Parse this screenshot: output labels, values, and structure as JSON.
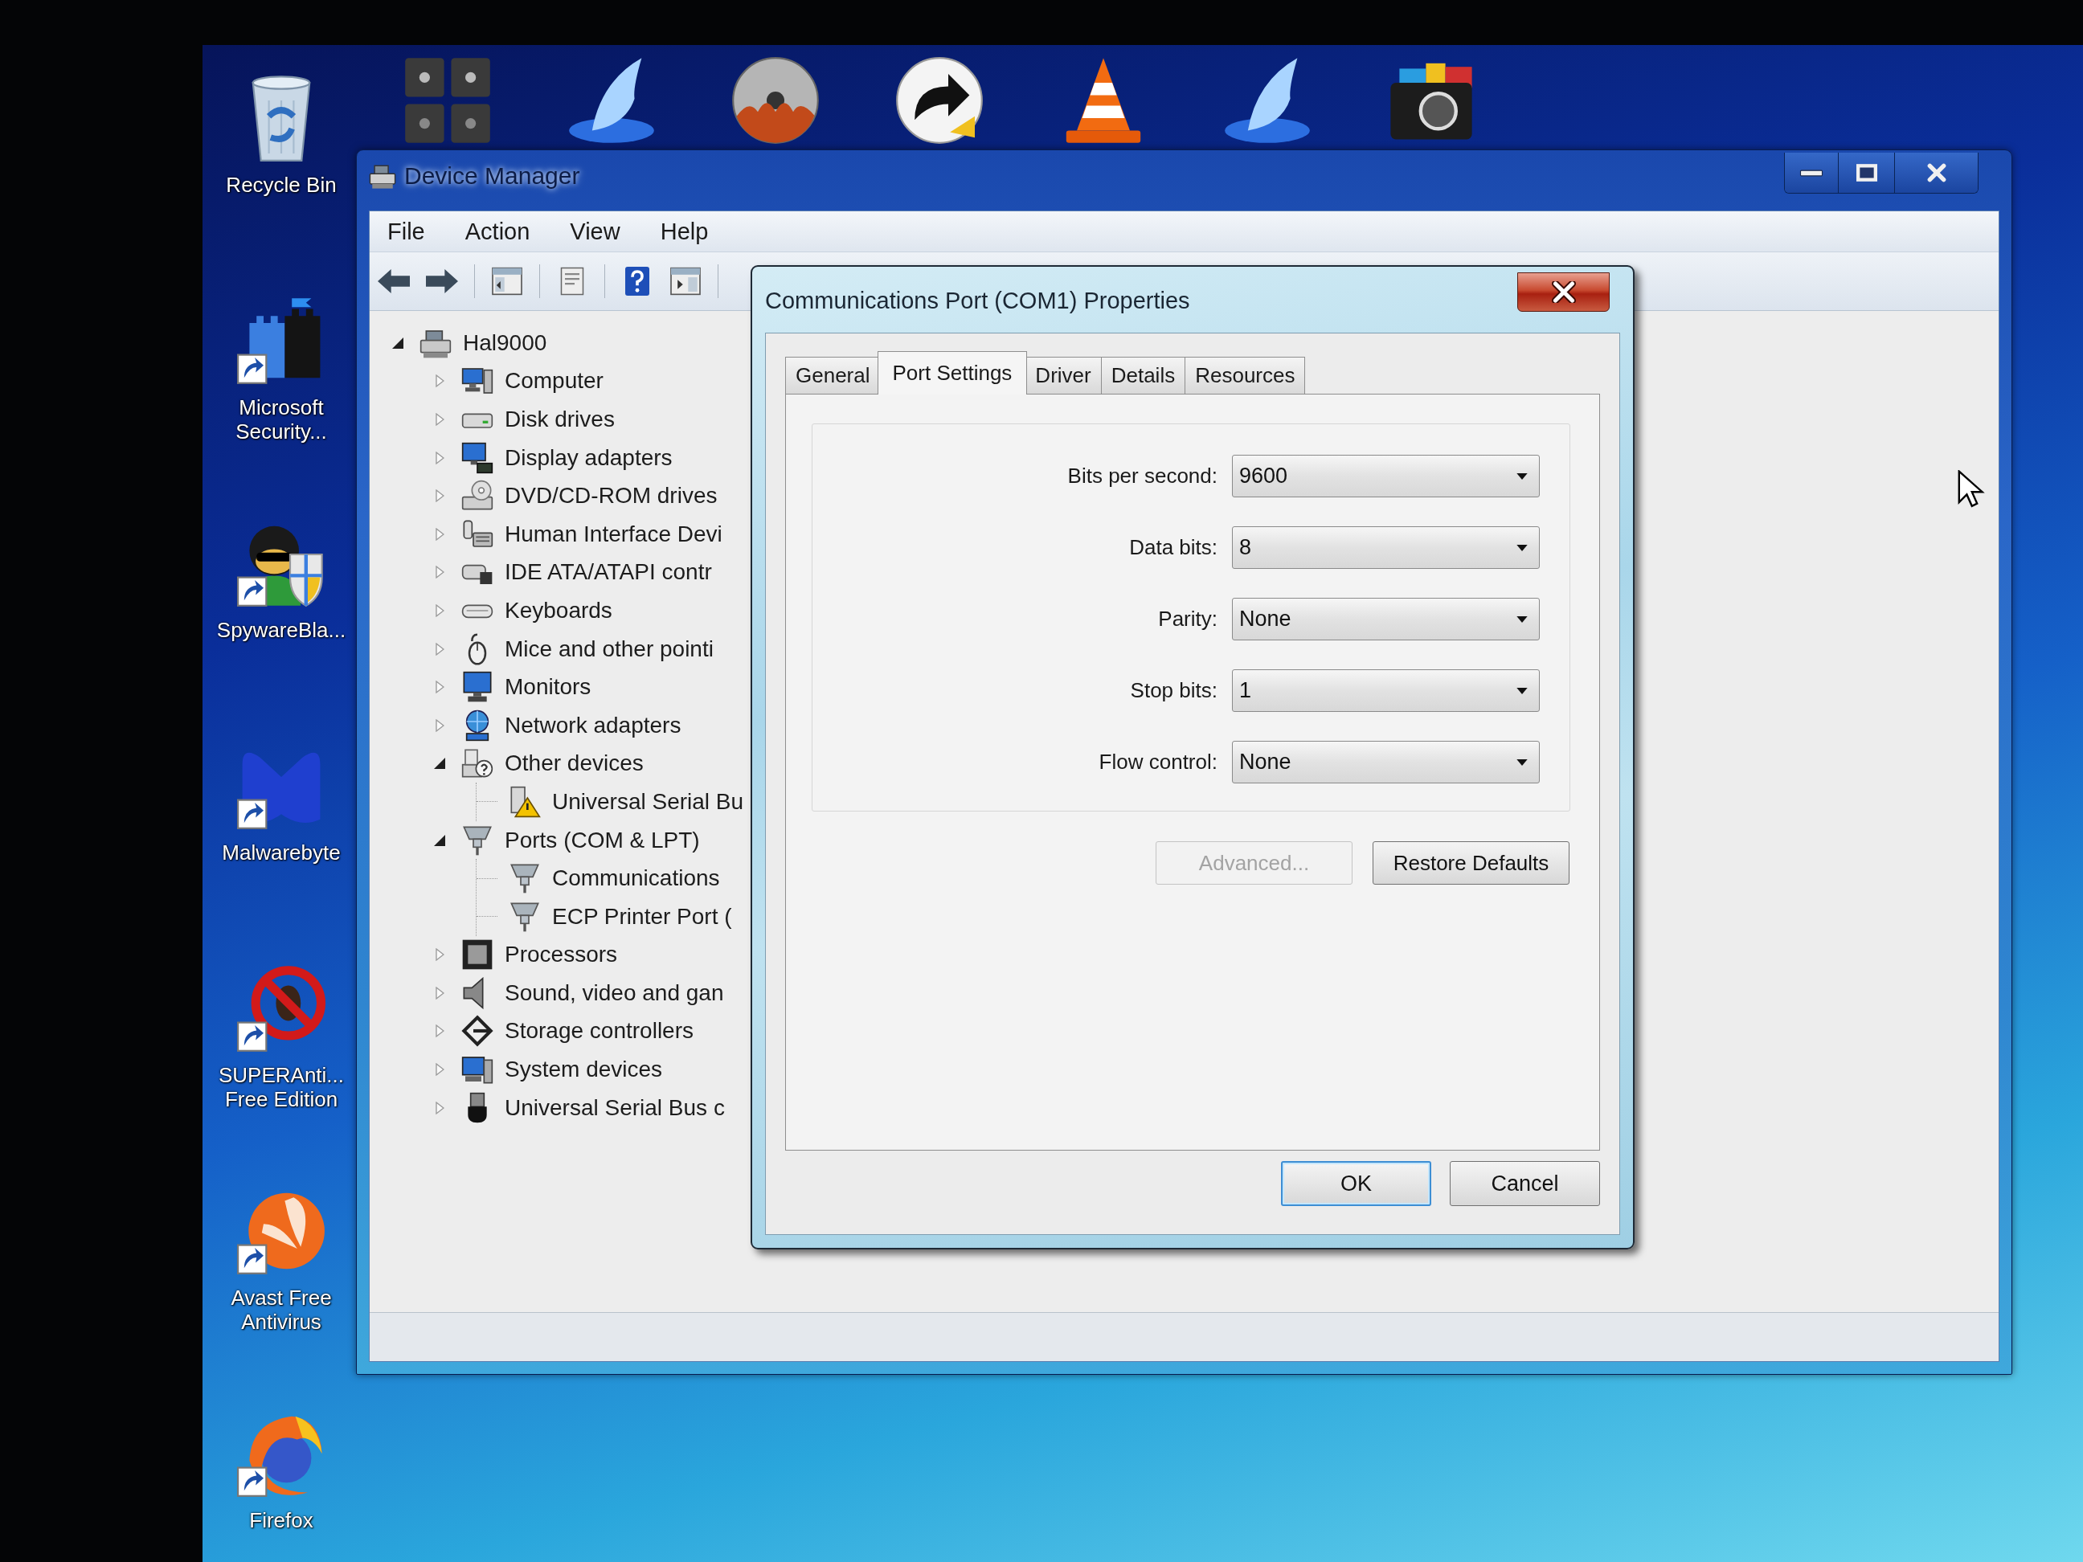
{
  "desktop": {
    "icons": [
      {
        "label": "Recycle Bin"
      },
      {
        "label": "Microsoft Security..."
      },
      {
        "label": "SpywareBla..."
      },
      {
        "label": "Malwarebyte"
      },
      {
        "label": "SUPERAnti... Free Edition"
      },
      {
        "label": "Avast Free Antivirus"
      },
      {
        "label": "Firefox"
      }
    ]
  },
  "device_manager": {
    "title": "Device Manager",
    "menu": [
      "File",
      "Action",
      "View",
      "Help"
    ],
    "tree": {
      "label": "Hal9000",
      "expanded": true,
      "children": [
        {
          "label": "Computer",
          "expanded": false
        },
        {
          "label": "Disk drives",
          "expanded": false
        },
        {
          "label": "Display adapters",
          "expanded": false
        },
        {
          "label": "DVD/CD-ROM drives",
          "expanded": false
        },
        {
          "label": "Human Interface Devi",
          "expanded": false
        },
        {
          "label": "IDE ATA/ATAPI contr",
          "expanded": false
        },
        {
          "label": "Keyboards",
          "expanded": false
        },
        {
          "label": "Mice and other pointi",
          "expanded": false
        },
        {
          "label": "Monitors",
          "expanded": false
        },
        {
          "label": "Network adapters",
          "expanded": false
        },
        {
          "label": "Other devices",
          "expanded": true,
          "children": [
            {
              "label": "Universal Serial Bu"
            }
          ]
        },
        {
          "label": "Ports (COM & LPT)",
          "expanded": true,
          "children": [
            {
              "label": "Communications"
            },
            {
              "label": "ECP Printer Port ("
            }
          ]
        },
        {
          "label": "Processors",
          "expanded": false
        },
        {
          "label": "Sound, video and gan",
          "expanded": false
        },
        {
          "label": "Storage controllers",
          "expanded": false
        },
        {
          "label": "System devices",
          "expanded": false
        },
        {
          "label": "Universal Serial Bus c",
          "expanded": false
        }
      ]
    }
  },
  "dialog": {
    "title": "Communications Port (COM1) Properties",
    "tabs": [
      {
        "label": "General",
        "selected": false
      },
      {
        "label": "Port Settings",
        "selected": true
      },
      {
        "label": "Driver",
        "selected": false
      },
      {
        "label": "Details",
        "selected": false
      },
      {
        "label": "Resources",
        "selected": false
      }
    ],
    "settings": [
      {
        "label": "Bits per second:",
        "value": "9600"
      },
      {
        "label": "Data bits:",
        "value": "8"
      },
      {
        "label": "Parity:",
        "value": "None"
      },
      {
        "label": "Stop bits:",
        "value": "1"
      },
      {
        "label": "Flow control:",
        "value": "None"
      }
    ],
    "buttons": [
      {
        "label": "Advanced...",
        "disabled": true
      },
      {
        "label": "Restore Defaults",
        "disabled": false
      }
    ],
    "footer_buttons": [
      {
        "label": "OK",
        "default": true
      },
      {
        "label": "Cancel",
        "default": false
      }
    ]
  }
}
